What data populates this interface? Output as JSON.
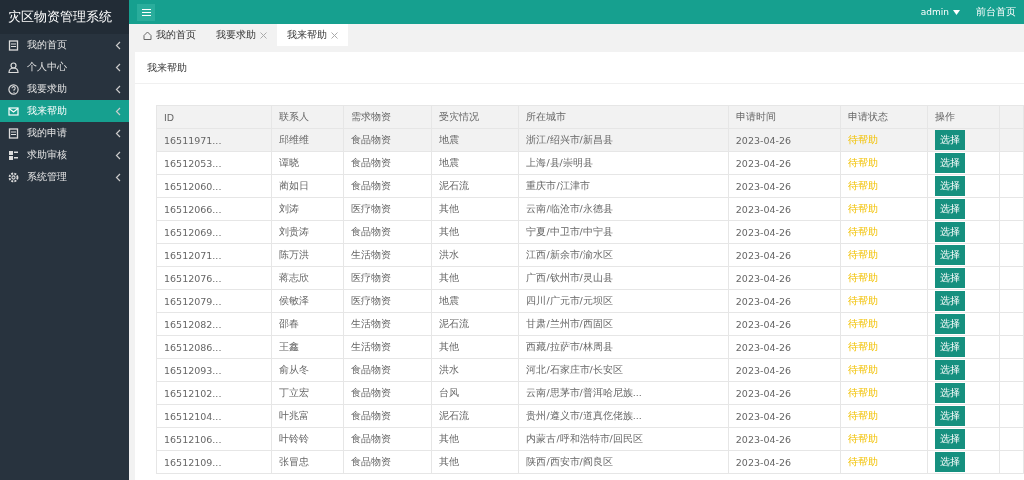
{
  "sidebar": {
    "title": "灾区物资管理系统",
    "items": [
      {
        "label": "我的首页",
        "selected": false
      },
      {
        "label": "个人中心",
        "selected": false
      },
      {
        "label": "我要求助",
        "selected": false
      },
      {
        "label": "我来帮助",
        "selected": true
      },
      {
        "label": "我的申请",
        "selected": false
      },
      {
        "label": "求助审核",
        "selected": false
      },
      {
        "label": "系统管理",
        "selected": false
      }
    ]
  },
  "header": {
    "user": "admin",
    "link": "前台首页"
  },
  "tabs": [
    {
      "label": "我的首页",
      "kind": "home",
      "selected": false
    },
    {
      "label": "我要求助",
      "kind": "closable",
      "selected": false
    },
    {
      "label": "我来帮助",
      "kind": "closable",
      "selected": true
    }
  ],
  "panel": {
    "title": "我来帮助"
  },
  "table": {
    "columns": [
      "ID",
      "联系人",
      "需求物资",
      "受灾情况",
      "所在城市",
      "申请时间",
      "申请状态",
      "操作"
    ],
    "rows": [
      {
        "cells": [
          "16511971...",
          "邱维维",
          "食品物资",
          "地震",
          "浙江/绍兴市/新昌县",
          "2023-04-26",
          "待帮助"
        ],
        "action": "选择",
        "selected": true
      },
      {
        "cells": [
          "16512053...",
          "谭晓",
          "食品物资",
          "地震",
          "上海/县/崇明县",
          "2023-04-26",
          "待帮助"
        ],
        "action": "选择",
        "selected": false
      },
      {
        "cells": [
          "16512060...",
          "蔺如日",
          "食品物资",
          "泥石流",
          "重庆市/江津市",
          "2023-04-26",
          "待帮助"
        ],
        "action": "选择",
        "selected": false
      },
      {
        "cells": [
          "16512066...",
          "刘涛",
          "医疗物资",
          "其他",
          "云南/临沧市/永德县",
          "2023-04-26",
          "待帮助"
        ],
        "action": "选择",
        "selected": false
      },
      {
        "cells": [
          "16512069...",
          "刘贵涛",
          "食品物资",
          "其他",
          "宁夏/中卫市/中宁县",
          "2023-04-26",
          "待帮助"
        ],
        "action": "选择",
        "selected": false
      },
      {
        "cells": [
          "16512071...",
          "陈万洪",
          "生活物资",
          "洪水",
          "江西/新余市/渝水区",
          "2023-04-26",
          "待帮助"
        ],
        "action": "选择",
        "selected": false
      },
      {
        "cells": [
          "16512076...",
          "蒋志欣",
          "医疗物资",
          "其他",
          "广西/钦州市/灵山县",
          "2023-04-26",
          "待帮助"
        ],
        "action": "选择",
        "selected": false
      },
      {
        "cells": [
          "16512079...",
          "侯敏泽",
          "医疗物资",
          "地震",
          "四川/广元市/元坝区",
          "2023-04-26",
          "待帮助"
        ],
        "action": "选择",
        "selected": false
      },
      {
        "cells": [
          "16512082...",
          "邵春",
          "生活物资",
          "泥石流",
          "甘肃/兰州市/西固区",
          "2023-04-26",
          "待帮助"
        ],
        "action": "选择",
        "selected": false
      },
      {
        "cells": [
          "16512086...",
          "王鑫",
          "生活物资",
          "其他",
          "西藏/拉萨市/林周县",
          "2023-04-26",
          "待帮助"
        ],
        "action": "选择",
        "selected": false
      },
      {
        "cells": [
          "16512093...",
          "俞从冬",
          "食品物资",
          "洪水",
          "河北/石家庄市/长安区",
          "2023-04-26",
          "待帮助"
        ],
        "action": "选择",
        "selected": false
      },
      {
        "cells": [
          "16512102...",
          "丁立宏",
          "食品物资",
          "台风",
          "云南/思茅市/普洱哈尼族...",
          "2023-04-26",
          "待帮助"
        ],
        "action": "选择",
        "selected": false
      },
      {
        "cells": [
          "16512104...",
          "叶兆富",
          "食品物资",
          "泥石流",
          "贵州/遵义市/道真仡佬族...",
          "2023-04-26",
          "待帮助"
        ],
        "action": "选择",
        "selected": false
      },
      {
        "cells": [
          "16512106...",
          "叶铃铃",
          "食品物资",
          "其他",
          "内蒙古/呼和浩特市/回民区",
          "2023-04-26",
          "待帮助"
        ],
        "action": "选择",
        "selected": false
      },
      {
        "cells": [
          "16512109...",
          "张冒忠",
          "食品物资",
          "其他",
          "陕西/西安市/阎良区",
          "2023-04-26",
          "待帮助"
        ],
        "action": "选择",
        "selected": false
      }
    ]
  }
}
